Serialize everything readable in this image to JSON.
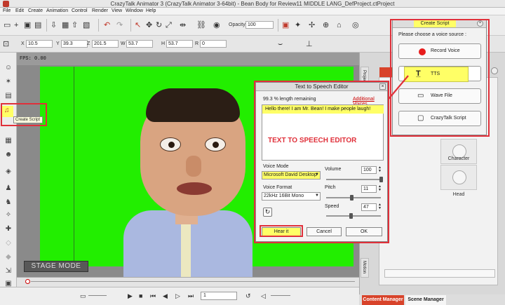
{
  "app": {
    "title": "CrazyTalk Animator 3  (CrazyTalk Animator 3-64bit) - Bean Body for Review11 MIDDLE LANG_DefProject.ctProject"
  },
  "menu": [
    "File",
    "Edit",
    "Create",
    "Animation",
    "Control",
    "Render",
    "View",
    "Window",
    "Help"
  ],
  "toolbar": {
    "opacity_label": "Opacity :",
    "opacity_value": "100"
  },
  "transform": {
    "x_label": "X",
    "x_value": "10.5",
    "y_label": "Y",
    "y_value": "39.3",
    "z_label": "Z",
    "z_value": "201.5",
    "w_label": "W",
    "w_value": "53.7",
    "h_label": "H",
    "h_value": "53.7",
    "r_label": "R",
    "r_value": "0"
  },
  "stage": {
    "fps": "FPS: 0.00",
    "mode": "STAGE MODE",
    "tooltip": "Create Script"
  },
  "tts_dialog": {
    "title": "Text to Speech Editor",
    "remaining": "99.3  % length remaining",
    "additional_voices": "Additional Voices",
    "text": "Hello there! I am Mr. Bean! I make people laugh!",
    "voice_mode_label": "Voice Mode",
    "voice_mode_value": "Microsoft David Desktop",
    "voice_format_label": "Voice Format",
    "voice_format_value": "22kHz 16Bit Mono",
    "volume_label": "Volume",
    "volume_value": "100",
    "pitch_label": "Pitch",
    "pitch_value": "11",
    "speed_label": "Speed",
    "speed_value": "47",
    "hear_it": "Hear it",
    "cancel": "Cancel",
    "ok": "OK"
  },
  "annotation": {
    "tts_editor": "TEXT TO SPEECH EDITOR",
    "color": "#e0303a"
  },
  "create_script": {
    "title": "Create Script",
    "prompt": "Please choose a voice source :",
    "options": [
      "Record Voice",
      "TTS",
      "Wave File",
      "CrazyTalk Script"
    ]
  },
  "right_panel": {
    "side_tab": "Project",
    "character_label": "Character",
    "head_label": "Head",
    "side_tab2": "Motion"
  },
  "playback": {
    "frame": "1"
  },
  "bottom_tabs": {
    "content_manager": "Content Manager",
    "scene_manager": "Scene Manager"
  },
  "colors": {
    "stage_green": "#22ee00",
    "highlight_yellow": "#ffff66",
    "accent_red": "#d8432a"
  }
}
